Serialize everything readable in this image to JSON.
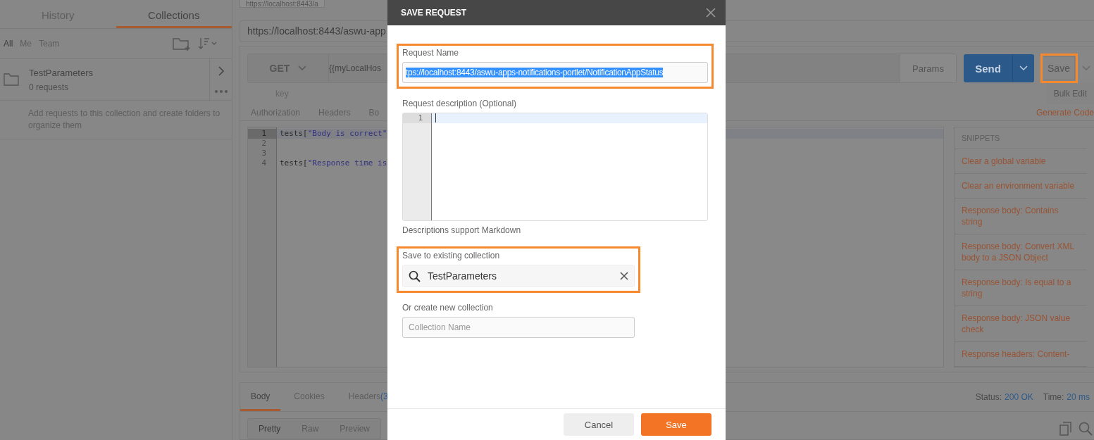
{
  "sidebar": {
    "tabs": [
      {
        "label": "History",
        "selected": false
      },
      {
        "label": "Collections",
        "selected": true
      }
    ],
    "filters": [
      {
        "label": "All",
        "selected": true
      },
      {
        "label": "Me",
        "selected": false
      },
      {
        "label": "Team",
        "selected": false
      }
    ],
    "collections": [
      {
        "name": "TestParameters",
        "count": "0 requests"
      }
    ],
    "hint": "Add requests to this collection and create folders to organize them"
  },
  "request_tab": {
    "label": "https://localhost:8443/a"
  },
  "url_title": "https://localhost:8443/aswu-app",
  "request": {
    "method": "GET",
    "url": "{{myLocalHos",
    "params_label": "Params",
    "send_label": "Send",
    "save_label": "Save",
    "save_highlighted": true,
    "key_placeholder": "key",
    "bulk_edit": "Bulk Edit",
    "tabs": [
      {
        "label": "Authorization"
      },
      {
        "label": "Headers"
      },
      {
        "label": "Bo"
      }
    ],
    "generate_code": "Generate Code"
  },
  "editor": {
    "lines": [
      {
        "number": "1",
        "current": true,
        "parts": [
          {
            "kind": "plain",
            "text": "tests["
          },
          {
            "kind": "string",
            "text": "\"Body is correct\""
          }
        ]
      },
      {
        "number": "2",
        "current": false
      },
      {
        "number": "3",
        "current": false
      },
      {
        "number": "4",
        "current": false,
        "parts": [
          {
            "kind": "plain",
            "text": "tests["
          },
          {
            "kind": "string",
            "text": "\"Response time is"
          }
        ]
      }
    ]
  },
  "snippets": {
    "title": "SNIPPETS",
    "items": [
      "Clear a global variable",
      "Clear an environment variable",
      "Response body: Contains string",
      "Response body: Convert XML body to a JSON Object",
      "Response body: Is equal to a string",
      "Response body: JSON value check",
      "Response headers: Content-"
    ]
  },
  "response": {
    "tabs": [
      {
        "label": "Body",
        "selected": true
      },
      {
        "label": "Cookies",
        "selected": false
      },
      {
        "label": "Headers",
        "count": "(3",
        "selected": false
      }
    ],
    "status_label": "Status:",
    "status": "200 OK",
    "time_label": "Time:",
    "time": "20 ms",
    "views": [
      {
        "label": "Pretty",
        "selected": true
      },
      {
        "label": "Raw",
        "selected": false
      },
      {
        "label": "Preview",
        "selected": false
      }
    ]
  },
  "dialog": {
    "title": "SAVE REQUEST",
    "name_label": "Request Name",
    "name_value": "tps://localhost:8443/aswu-apps-notifications-portlet/NotificationAppStatus",
    "name_selected": true,
    "name_highlighted": true,
    "description_label": "Request description (Optional)",
    "description_line": "1",
    "description_hint": "Descriptions support Markdown",
    "existing_label": "Save to existing collection",
    "existing_value": "TestParameters",
    "existing_highlighted": true,
    "new_label": "Or create new collection",
    "new_placeholder": "Collection Name",
    "buttons": [
      {
        "label": "Cancel",
        "kind": "secondary"
      },
      {
        "label": "Save",
        "kind": "primary"
      }
    ]
  }
}
